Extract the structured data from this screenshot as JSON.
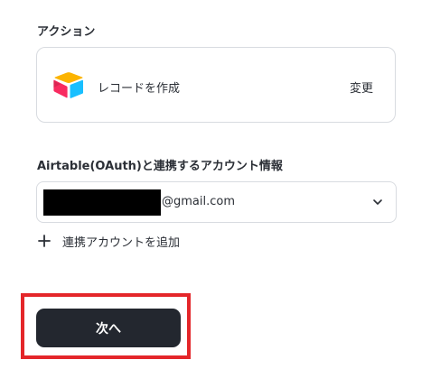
{
  "action_section": {
    "label": "アクション",
    "app_icon": "airtable-logo",
    "action_name": "レコードを作成",
    "change_label": "変更"
  },
  "account_section": {
    "label": "Airtable(OAuth)と連携するアカウント情報",
    "selected_account": "@gmail.com",
    "dropdown_icon": "chevron-down-icon",
    "add_account_icon": "plus-icon",
    "add_account_label": "連携アカウントを追加"
  },
  "footer": {
    "next_label": "次へ"
  },
  "colors": {
    "primary_button": "#23272f",
    "highlight_border": "#e4262a",
    "card_border": "#d8dbe0",
    "logo_yellow": "#fcb400",
    "logo_blue": "#18bfff",
    "logo_red": "#f82b60"
  }
}
